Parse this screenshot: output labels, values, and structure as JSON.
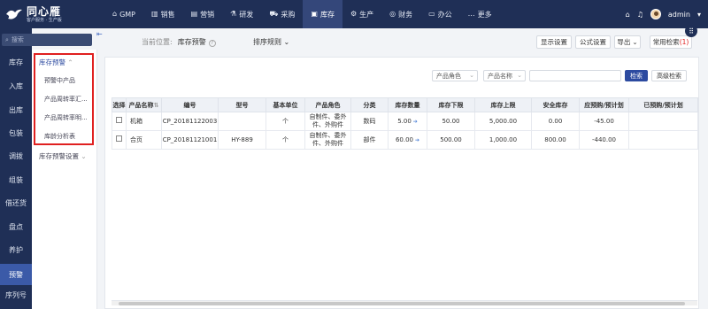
{
  "app": {
    "logo_main": "同心雁",
    "logo_sub": "客户服务 · 生产版"
  },
  "topnav": {
    "items": [
      {
        "label": "GMP",
        "icon": "home-icon"
      },
      {
        "label": "销售",
        "icon": "bar-chart-icon"
      },
      {
        "label": "营销",
        "icon": "chart-icon"
      },
      {
        "label": "研发",
        "icon": "flask-icon"
      },
      {
        "label": "采购",
        "icon": "cart-icon"
      },
      {
        "label": "库存",
        "icon": "box-icon",
        "active": true
      },
      {
        "label": "生产",
        "icon": "factory-icon"
      },
      {
        "label": "财务",
        "icon": "money-icon"
      },
      {
        "label": "办公",
        "icon": "briefcase-icon"
      },
      {
        "label": "更多",
        "icon": "ellipsis-icon"
      }
    ],
    "user": "admin"
  },
  "leftnav": {
    "search_placeholder": "搜索",
    "items": [
      "库存",
      "入库",
      "出库",
      "包装",
      "调拨",
      "组装",
      "借还货",
      "盘点",
      "养护",
      "预警",
      "序列号"
    ],
    "active": "预警"
  },
  "subnav": {
    "group1": "库存预警",
    "items": [
      "预警中产品",
      "产品周转率汇...",
      "产品周转率明...",
      "库龄分析表"
    ],
    "group2": "库存预警设置"
  },
  "header": {
    "crumb_label": "当前位置:",
    "crumb_value": "库存预警",
    "sort_label": "排序规则",
    "buttons": {
      "display": "显示设置",
      "formula": "公式设置",
      "export": "导出",
      "common_search": "常用检索",
      "common_search_count": "(1)"
    }
  },
  "filters": {
    "role_placeholder": "产品角色",
    "name_placeholder": "产品名称",
    "search_btn": "检索",
    "advanced_btn": "高级检索"
  },
  "table": {
    "columns": [
      "选择",
      "产品名称",
      "编号",
      "型号",
      "基本单位",
      "产品角色",
      "分类",
      "库存数量",
      "库存下限",
      "库存上限",
      "安全库存",
      "应预购/预计划",
      "已预购/预计划"
    ],
    "rows": [
      {
        "name": "机箱",
        "code": "CP_20181122003",
        "model": "",
        "unit": "个",
        "role": "自制件、委外件、外购件",
        "category": "数码",
        "qty": "5.00",
        "min": "50.00",
        "max": "5,000.00",
        "safety": "0.00",
        "need": "-45.00",
        "done": ""
      },
      {
        "name": "合页",
        "code": "CP_20181121001",
        "model": "HY-889",
        "unit": "个",
        "role": "自制件、委外件、外购件",
        "category": "部件",
        "qty": "60.00",
        "min": "500.00",
        "max": "1,000.00",
        "safety": "800.00",
        "need": "-440.00",
        "done": ""
      }
    ]
  }
}
